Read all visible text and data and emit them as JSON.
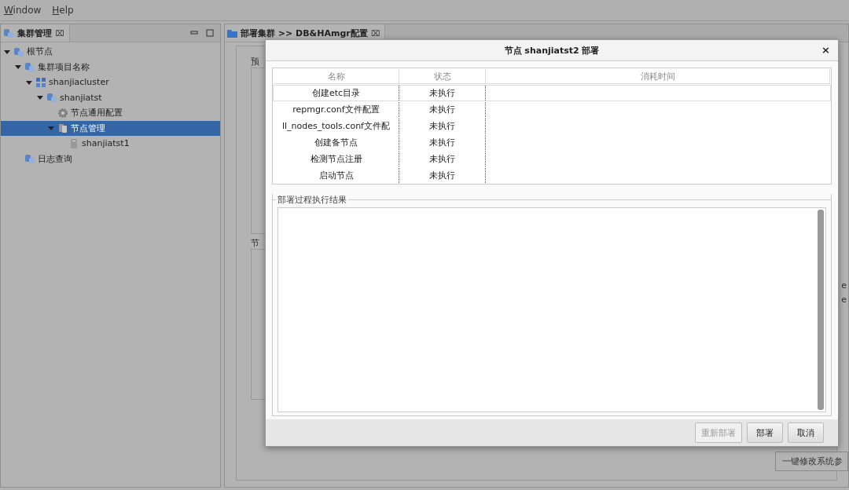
{
  "menu": [
    {
      "label": "Window"
    },
    {
      "label": "Help"
    }
  ],
  "left_panel": {
    "tab": {
      "label": "集群管理",
      "close": "⌧"
    },
    "tree": [
      {
        "label": "根节点",
        "kind": "db",
        "expanded": true,
        "selected": false,
        "children": [
          {
            "label": "集群项目名称",
            "kind": "db",
            "expanded": true,
            "selected": false,
            "children": [
              {
                "label": "shanjiacluster",
                "kind": "cluster",
                "expanded": true,
                "selected": false,
                "children": [
                  {
                    "label": "shanjiatst",
                    "kind": "db",
                    "expanded": true,
                    "selected": false,
                    "children": [
                      {
                        "label": "节点通用配置",
                        "kind": "gear",
                        "selected": false
                      },
                      {
                        "label": "节点管理",
                        "kind": "servers",
                        "expanded": true,
                        "selected": true,
                        "children": [
                          {
                            "label": "shanjiatst1",
                            "kind": "server",
                            "selected": false
                          }
                        ]
                      }
                    ]
                  }
                ]
              }
            ]
          },
          {
            "label": "日志查询",
            "kind": "db",
            "selected": false
          }
        ]
      }
    ]
  },
  "editor": {
    "tab": {
      "label": "部署集群 >> DB&HAmgr配置",
      "close": "⌧"
    },
    "group_1": "预",
    "group_2": "节",
    "fragments": [
      "e",
      "e"
    ],
    "button": "一键修改系统参"
  },
  "dialog": {
    "title": "节点 shanjiatst2 部署",
    "close": "×",
    "table": {
      "columns": [
        "名称",
        "状态",
        "消耗时间"
      ],
      "rows": [
        {
          "name": "创建etc目录",
          "status": "未执行",
          "selected": true
        },
        {
          "name": "repmgr.conf文件配置",
          "status": "未执行",
          "selected": false
        },
        {
          "name": "ll_nodes_tools.conf文件配",
          "status": "未执行",
          "selected": false
        },
        {
          "name": "创建备节点",
          "status": "未执行",
          "selected": false
        },
        {
          "name": "检测节点注册",
          "status": "未执行",
          "selected": false
        },
        {
          "name": "启动节点",
          "status": "未执行",
          "selected": false
        }
      ]
    },
    "result_label": "部署过程执行结果",
    "buttons": [
      {
        "label": "重新部署",
        "disabled": true
      },
      {
        "label": "部署",
        "disabled": false
      },
      {
        "label": "取消",
        "disabled": false
      }
    ]
  }
}
